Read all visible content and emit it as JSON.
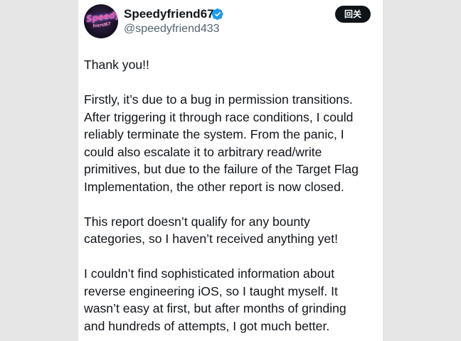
{
  "author": {
    "display_name": "Speedyfriend67",
    "handle": "@speedyfriend433",
    "avatar_logo_line1": "Speedy",
    "avatar_logo_line2": "friend67",
    "verified": true,
    "verified_icon": "verified-badge-icon"
  },
  "follow_button": {
    "label": "回关"
  },
  "tweet": {
    "paragraphs": [
      {
        "lines": [
          "Thank you!!"
        ]
      },
      {
        "lines": [
          "Firstly, it’s due to a bug in permission transitions.",
          "After triggering it through race conditions, I could",
          "reliably terminate the system. From the panic, I",
          "could also escalate it to arbitrary read/write",
          "primitives, but due to the failure of the Target Flag",
          "Implementation, the other report is now closed."
        ]
      },
      {
        "lines": [
          "This report doesn’t qualify for any bounty",
          "categories, so I haven’t received anything yet!"
        ]
      },
      {
        "lines": [
          "I couldn’t find sophisticated information about",
          "reverse engineering iOS, so I taught myself. It",
          "wasn’t easy at first, but after months of grinding",
          "and hundreds of attempts, I got much better."
        ]
      }
    ]
  },
  "colors": {
    "page_background": "#e6e6e6",
    "card_background": "#ffffff",
    "text_primary": "#0f1419",
    "text_secondary": "#536471",
    "verified_blue": "#1d9bf0",
    "button_background": "#0f1419",
    "button_text": "#ffffff"
  }
}
